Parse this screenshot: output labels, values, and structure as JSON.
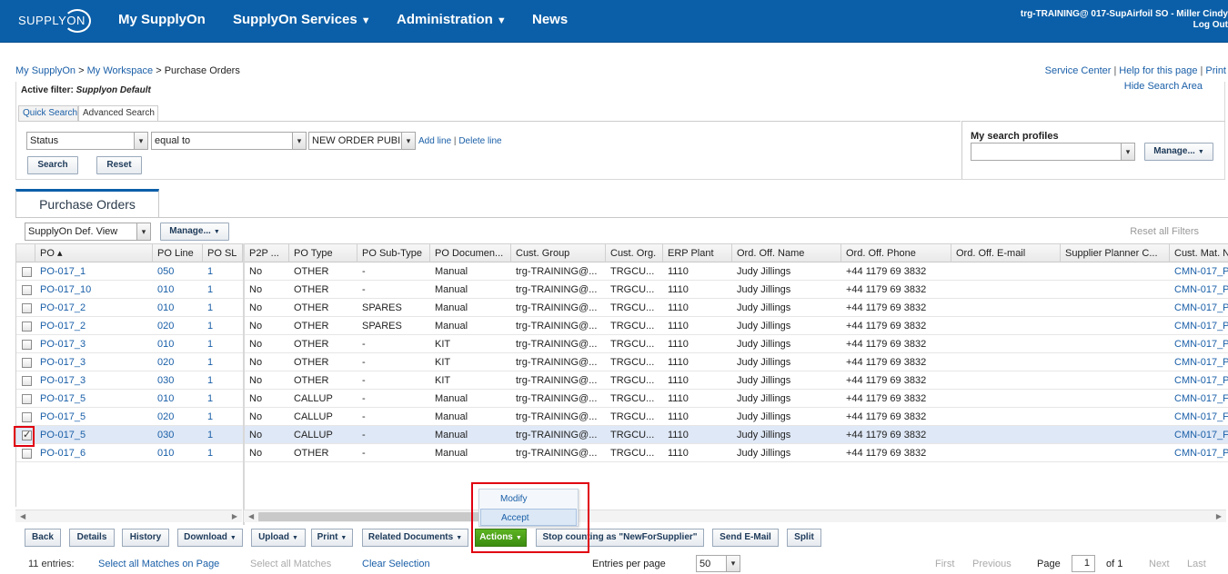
{
  "header": {
    "logo_text": "SUPPLY",
    "logo_text2": "ON",
    "nav": [
      {
        "label": "My SupplyOn",
        "caret": ""
      },
      {
        "label": "SupplyOn Services",
        "caret": "▼"
      },
      {
        "label": "Administration",
        "caret": "▼"
      },
      {
        "label": "News",
        "caret": ""
      }
    ],
    "user_line1": "trg-TRAINING@ 017-SupAirfoil SO - Miller Cindy",
    "user_line2": "Log Out"
  },
  "breadcrumb": {
    "items": [
      "My SupplyOn",
      "My Workspace"
    ],
    "separator": ">",
    "current": "Purchase Orders"
  },
  "toplinks": [
    "Service Center",
    "Help for this page",
    "Print"
  ],
  "toplinks_sep": "|",
  "hide_search": "Hide Search Area",
  "filter": {
    "active_label": "Active filter:",
    "active_value": "Supplyon Default",
    "tabs": [
      "Quick Search",
      "Advanced Search"
    ],
    "field": "Status",
    "operator": "equal to",
    "value": "NEW ORDER PUBI",
    "add_line": "Add line",
    "delete_line": "Delete line",
    "link_sep": "|",
    "search_btn": "Search",
    "reset_btn": "Reset",
    "profiles_label": "My search profiles",
    "profiles_value": "",
    "manage_btn": "Manage..."
  },
  "section_title": "Purchase Orders",
  "view_select": "SupplyOn Def. View",
  "view_manage": "Manage...",
  "reset_filters": "Reset all Filters",
  "columns": [
    "PO ▴",
    "PO Line",
    "PO SL",
    "P2P ...",
    "PO Type",
    "PO Sub-Type",
    "PO Documen...",
    "Cust. Group",
    "Cust. Org.",
    "ERP Plant",
    "Ord. Off. Name",
    "Ord. Off. Phone",
    "Ord. Off. E-mail",
    "Supplier Planner C...",
    "Cust. Mat. N"
  ],
  "rows": [
    {
      "po": "PO-017_1",
      "line": "050",
      "sl": "1",
      "p2p": "No",
      "type": "OTHER",
      "sub": "-",
      "doc": "Manual",
      "group": "trg-TRAINING@...",
      "org": "TRGCU...",
      "plant": "1110",
      "name": "Judy Jillings",
      "phone": "+44 1179 69 3832",
      "email": "",
      "planner": "",
      "mat": "CMN-017_P",
      "checked": false
    },
    {
      "po": "PO-017_10",
      "line": "010",
      "sl": "1",
      "p2p": "No",
      "type": "OTHER",
      "sub": "-",
      "doc": "Manual",
      "group": "trg-TRAINING@...",
      "org": "TRGCU...",
      "plant": "1110",
      "name": "Judy Jillings",
      "phone": "+44 1179 69 3832",
      "email": "",
      "planner": "",
      "mat": "CMN-017_P",
      "checked": false
    },
    {
      "po": "PO-017_2",
      "line": "010",
      "sl": "1",
      "p2p": "No",
      "type": "OTHER",
      "sub": "SPARES",
      "doc": "Manual",
      "group": "trg-TRAINING@...",
      "org": "TRGCU...",
      "plant": "1110",
      "name": "Judy Jillings",
      "phone": "+44 1179 69 3832",
      "email": "",
      "planner": "",
      "mat": "CMN-017_P",
      "checked": false
    },
    {
      "po": "PO-017_2",
      "line": "020",
      "sl": "1",
      "p2p": "No",
      "type": "OTHER",
      "sub": "SPARES",
      "doc": "Manual",
      "group": "trg-TRAINING@...",
      "org": "TRGCU...",
      "plant": "1110",
      "name": "Judy Jillings",
      "phone": "+44 1179 69 3832",
      "email": "",
      "planner": "",
      "mat": "CMN-017_P",
      "checked": false
    },
    {
      "po": "PO-017_3",
      "line": "010",
      "sl": "1",
      "p2p": "No",
      "type": "OTHER",
      "sub": "-",
      "doc": "KIT",
      "group": "trg-TRAINING@...",
      "org": "TRGCU...",
      "plant": "1110",
      "name": "Judy Jillings",
      "phone": "+44 1179 69 3832",
      "email": "",
      "planner": "",
      "mat": "CMN-017_P",
      "checked": false
    },
    {
      "po": "PO-017_3",
      "line": "020",
      "sl": "1",
      "p2p": "No",
      "type": "OTHER",
      "sub": "-",
      "doc": "KIT",
      "group": "trg-TRAINING@...",
      "org": "TRGCU...",
      "plant": "1110",
      "name": "Judy Jillings",
      "phone": "+44 1179 69 3832",
      "email": "",
      "planner": "",
      "mat": "CMN-017_P",
      "checked": false
    },
    {
      "po": "PO-017_3",
      "line": "030",
      "sl": "1",
      "p2p": "No",
      "type": "OTHER",
      "sub": "-",
      "doc": "KIT",
      "group": "trg-TRAINING@...",
      "org": "TRGCU...",
      "plant": "1110",
      "name": "Judy Jillings",
      "phone": "+44 1179 69 3832",
      "email": "",
      "planner": "",
      "mat": "CMN-017_P",
      "checked": false
    },
    {
      "po": "PO-017_5",
      "line": "010",
      "sl": "1",
      "p2p": "No",
      "type": "CALLUP",
      "sub": "-",
      "doc": "Manual",
      "group": "trg-TRAINING@...",
      "org": "TRGCU...",
      "plant": "1110",
      "name": "Judy Jillings",
      "phone": "+44 1179 69 3832",
      "email": "",
      "planner": "",
      "mat": "CMN-017_F",
      "checked": false
    },
    {
      "po": "PO-017_5",
      "line": "020",
      "sl": "1",
      "p2p": "No",
      "type": "CALLUP",
      "sub": "-",
      "doc": "Manual",
      "group": "trg-TRAINING@...",
      "org": "TRGCU...",
      "plant": "1110",
      "name": "Judy Jillings",
      "phone": "+44 1179 69 3832",
      "email": "",
      "planner": "",
      "mat": "CMN-017_F",
      "checked": false
    },
    {
      "po": "PO-017_5",
      "line": "030",
      "sl": "1",
      "p2p": "No",
      "type": "CALLUP",
      "sub": "-",
      "doc": "Manual",
      "group": "trg-TRAINING@...",
      "org": "TRGCU...",
      "plant": "1110",
      "name": "Judy Jillings",
      "phone": "+44 1179 69 3832",
      "email": "",
      "planner": "",
      "mat": "CMN-017_F",
      "checked": true
    },
    {
      "po": "PO-017_6",
      "line": "010",
      "sl": "1",
      "p2p": "No",
      "type": "OTHER",
      "sub": "-",
      "doc": "Manual",
      "group": "trg-TRAINING@...",
      "org": "TRGCU...",
      "plant": "1110",
      "name": "Judy Jillings",
      "phone": "+44 1179 69 3832",
      "email": "",
      "planner": "",
      "mat": "CMN-017_P",
      "checked": false
    }
  ],
  "actions_menu": [
    "Modify",
    "Accept"
  ],
  "toolbar": [
    {
      "label": "Back",
      "caret": false,
      "green": false
    },
    {
      "label": "Details",
      "caret": false,
      "green": false
    },
    {
      "label": "History",
      "caret": false,
      "green": false
    },
    {
      "label": "Download",
      "caret": true,
      "green": false
    },
    {
      "label": "Upload",
      "caret": true,
      "green": false
    },
    {
      "label": "Print",
      "caret": true,
      "green": false
    },
    {
      "label": "Related Documents",
      "caret": true,
      "green": false
    },
    {
      "label": "Actions",
      "caret": true,
      "green": true
    },
    {
      "label": "Stop counting as \"NewForSupplier\"",
      "caret": false,
      "green": false
    },
    {
      "label": "Send E-Mail",
      "caret": false,
      "green": false
    },
    {
      "label": "Split",
      "caret": false,
      "green": false
    }
  ],
  "footer": {
    "entries": "11 entries:",
    "select_page": "Select all Matches on Page",
    "select_all": "Select all Matches",
    "clear": "Clear Selection",
    "per_page_label": "Entries per page",
    "per_page": "50",
    "first": "First",
    "previous": "Previous",
    "page_label": "Page",
    "page": "1",
    "of": "of 1",
    "next": "Next",
    "last": "Last"
  },
  "colors": {
    "brand_blue": "#0b5fa8",
    "action_green": "#4a9e19",
    "highlight_red": "#e00010",
    "selected_row": "#dfe8f6"
  }
}
